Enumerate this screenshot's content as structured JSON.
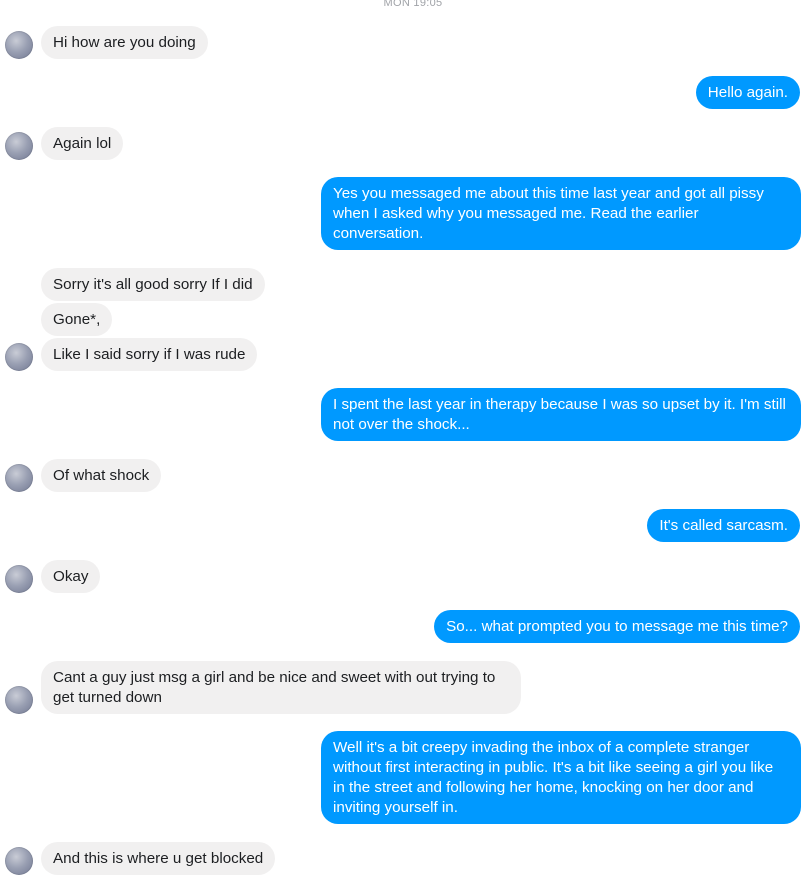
{
  "conversation": {
    "timestamp": "MON 19:05",
    "messages": [
      {
        "side": "in",
        "text": "Hi how are you doing"
      },
      {
        "side": "out",
        "text": "Hello again."
      },
      {
        "side": "in",
        "text": "Again lol"
      },
      {
        "side": "out",
        "text": "Yes you messaged me about this time last year and got all pissy when I asked why you messaged me. Read the earlier conversation."
      },
      {
        "side": "in",
        "text": "Sorry it's all good sorry If I did"
      },
      {
        "side": "in",
        "text": "Gone*,"
      },
      {
        "side": "in",
        "text": "Like I said sorry if I was rude"
      },
      {
        "side": "out",
        "text": "I spent the last year in therapy because I was so upset by it. I'm still not over the shock..."
      },
      {
        "side": "in",
        "text": "Of what shock"
      },
      {
        "side": "out",
        "text": "It's called sarcasm."
      },
      {
        "side": "in",
        "text": "Okay"
      },
      {
        "side": "out",
        "text": "So... what prompted you to message me this time?"
      },
      {
        "side": "in",
        "text": "Cant a guy just msg a girl and be nice and sweet with out trying to get turned down"
      },
      {
        "side": "out",
        "text": "Well it's a bit creepy invading the inbox of a complete stranger without first interacting in public. It's a bit like seeing a girl you like in the street and following her home,  knocking on her door and inviting yourself in."
      },
      {
        "side": "in",
        "text": "And this is where u get blocked"
      }
    ]
  },
  "colors": {
    "incoming_bubble": "#f1f0f0",
    "outgoing_bubble": "#0099ff",
    "incoming_text": "#1c1e21",
    "outgoing_text": "#ffffff"
  },
  "icons": {
    "contact_avatar": "profile-photo-avatar"
  }
}
